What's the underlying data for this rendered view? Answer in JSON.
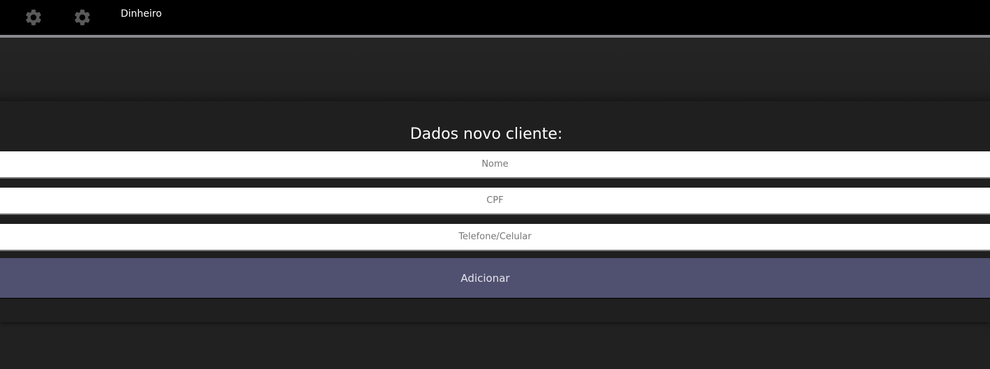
{
  "header": {
    "settings_icon_1": "gear-icon",
    "settings_icon_2": "gear-icon",
    "title": "Dinheiro"
  },
  "form": {
    "title": "Dados novo cliente:",
    "fields": [
      {
        "placeholder": "Nome",
        "value": ""
      },
      {
        "placeholder": "CPF",
        "value": ""
      },
      {
        "placeholder": "Telefone/Celular",
        "value": ""
      }
    ],
    "submit_label": "Adicionar"
  },
  "colors": {
    "topbar": "#000000",
    "background": "#212121",
    "button": "#505070",
    "field_background": "#ffffff"
  }
}
